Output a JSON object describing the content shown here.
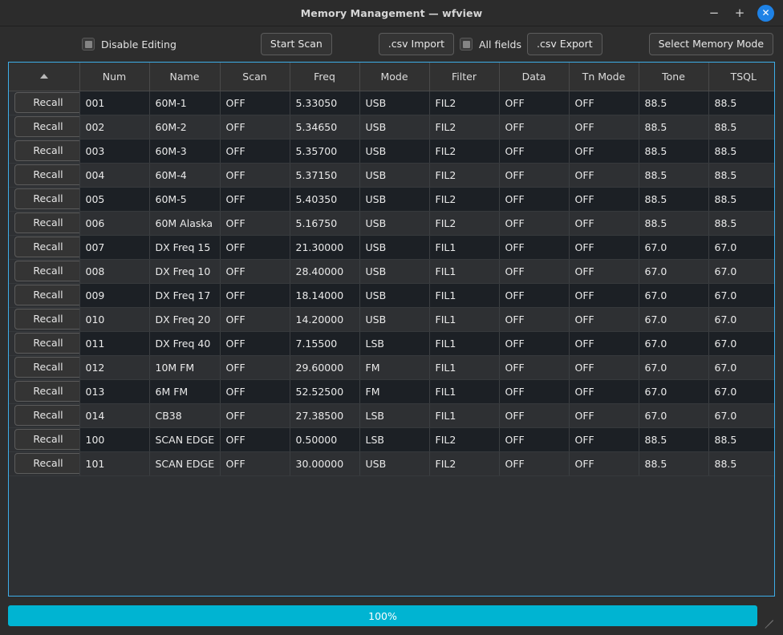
{
  "window": {
    "title": "Memory Management — wfview",
    "minimize_label": "−",
    "maximize_label": "+",
    "close_label": "✕"
  },
  "toolbar": {
    "disable_editing_label": "Disable Editing",
    "disable_editing_checked": false,
    "start_scan_label": "Start Scan",
    "csv_import_label": ".csv Import",
    "all_fields_label": "All fields",
    "all_fields_checked": false,
    "csv_export_label": ".csv Export",
    "select_memory_mode_label": "Select Memory Mode"
  },
  "table": {
    "sort_column": 0,
    "sort_direction": "ascending",
    "columns": [
      {
        "label": "",
        "key": "recall"
      },
      {
        "label": "Num",
        "key": "num"
      },
      {
        "label": "Name",
        "key": "name"
      },
      {
        "label": "Scan",
        "key": "scan"
      },
      {
        "label": "Freq",
        "key": "freq"
      },
      {
        "label": "Mode",
        "key": "mode"
      },
      {
        "label": "Filter",
        "key": "filter"
      },
      {
        "label": "Data",
        "key": "data"
      },
      {
        "label": "Tn Mode",
        "key": "tnmode"
      },
      {
        "label": "Tone",
        "key": "tone"
      },
      {
        "label": "TSQL",
        "key": "tsql"
      }
    ],
    "recall_label": "Recall",
    "rows": [
      {
        "num": "001",
        "name": "60M-1",
        "scan": "OFF",
        "freq": "5.33050",
        "mode": "USB",
        "filter": "FIL2",
        "data": "OFF",
        "tnmode": "OFF",
        "tone": "88.5",
        "tsql": "88.5",
        "tone_enabled": false
      },
      {
        "num": "002",
        "name": "60M-2",
        "scan": "OFF",
        "freq": "5.34650",
        "mode": "USB",
        "filter": "FIL2",
        "data": "OFF",
        "tnmode": "OFF",
        "tone": "88.5",
        "tsql": "88.5",
        "tone_enabled": false
      },
      {
        "num": "003",
        "name": "60M-3",
        "scan": "OFF",
        "freq": "5.35700",
        "mode": "USB",
        "filter": "FIL2",
        "data": "OFF",
        "tnmode": "OFF",
        "tone": "88.5",
        "tsql": "88.5",
        "tone_enabled": false
      },
      {
        "num": "004",
        "name": "60M-4",
        "scan": "OFF",
        "freq": "5.37150",
        "mode": "USB",
        "filter": "FIL2",
        "data": "OFF",
        "tnmode": "OFF",
        "tone": "88.5",
        "tsql": "88.5",
        "tone_enabled": false
      },
      {
        "num": "005",
        "name": "60M-5",
        "scan": "OFF",
        "freq": "5.40350",
        "mode": "USB",
        "filter": "FIL2",
        "data": "OFF",
        "tnmode": "OFF",
        "tone": "88.5",
        "tsql": "88.5",
        "tone_enabled": false
      },
      {
        "num": "006",
        "name": "60M Alaska",
        "scan": "OFF",
        "freq": "5.16750",
        "mode": "USB",
        "filter": "FIL2",
        "data": "OFF",
        "tnmode": "OFF",
        "tone": "88.5",
        "tsql": "88.5",
        "tone_enabled": false
      },
      {
        "num": "007",
        "name": "DX Freq 15",
        "scan": "OFF",
        "freq": "21.30000",
        "mode": "USB",
        "filter": "FIL1",
        "data": "OFF",
        "tnmode": "OFF",
        "tone": "67.0",
        "tsql": "67.0",
        "tone_enabled": false
      },
      {
        "num": "008",
        "name": "DX Freq 10",
        "scan": "OFF",
        "freq": "28.40000",
        "mode": "USB",
        "filter": "FIL1",
        "data": "OFF",
        "tnmode": "OFF",
        "tone": "67.0",
        "tsql": "67.0",
        "tone_enabled": false
      },
      {
        "num": "009",
        "name": "DX Freq 17",
        "scan": "OFF",
        "freq": "18.14000",
        "mode": "USB",
        "filter": "FIL1",
        "data": "OFF",
        "tnmode": "OFF",
        "tone": "67.0",
        "tsql": "67.0",
        "tone_enabled": false
      },
      {
        "num": "010",
        "name": "DX Freq 20",
        "scan": "OFF",
        "freq": "14.20000",
        "mode": "USB",
        "filter": "FIL1",
        "data": "OFF",
        "tnmode": "OFF",
        "tone": "67.0",
        "tsql": "67.0",
        "tone_enabled": false
      },
      {
        "num": "011",
        "name": "DX Freq 40",
        "scan": "OFF",
        "freq": "7.15500",
        "mode": "LSB",
        "filter": "FIL1",
        "data": "OFF",
        "tnmode": "OFF",
        "tone": "67.0",
        "tsql": "67.0",
        "tone_enabled": false
      },
      {
        "num": "012",
        "name": "10M FM",
        "scan": "OFF",
        "freq": "29.60000",
        "mode": "FM",
        "filter": "FIL1",
        "data": "OFF",
        "tnmode": "OFF",
        "tone": "67.0",
        "tsql": "67.0",
        "tone_enabled": true
      },
      {
        "num": "013",
        "name": "6M FM",
        "scan": "OFF",
        "freq": "52.52500",
        "mode": "FM",
        "filter": "FIL1",
        "data": "OFF",
        "tnmode": "OFF",
        "tone": "67.0",
        "tsql": "67.0",
        "tone_enabled": true
      },
      {
        "num": "014",
        "name": "CB38",
        "scan": "OFF",
        "freq": "27.38500",
        "mode": "LSB",
        "filter": "FIL1",
        "data": "OFF",
        "tnmode": "OFF",
        "tone": "67.0",
        "tsql": "67.0",
        "tone_enabled": false
      },
      {
        "num": "100",
        "name": "SCAN EDGE",
        "scan": "OFF",
        "freq": "0.50000",
        "mode": "LSB",
        "filter": "FIL2",
        "data": "OFF",
        "tnmode": "OFF",
        "tone": "88.5",
        "tsql": "88.5",
        "tone_enabled": false
      },
      {
        "num": "101",
        "name": "SCAN EDGE",
        "scan": "OFF",
        "freq": "30.00000",
        "mode": "USB",
        "filter": "FIL2",
        "data": "OFF",
        "tnmode": "OFF",
        "tone": "88.5",
        "tsql": "88.5",
        "tone_enabled": false
      }
    ]
  },
  "footer": {
    "progress_label": "100%",
    "progress_percent": 100
  },
  "colors": {
    "accent": "#3daee9",
    "progress": "#00b4d2",
    "close_button": "#1e82e6"
  }
}
